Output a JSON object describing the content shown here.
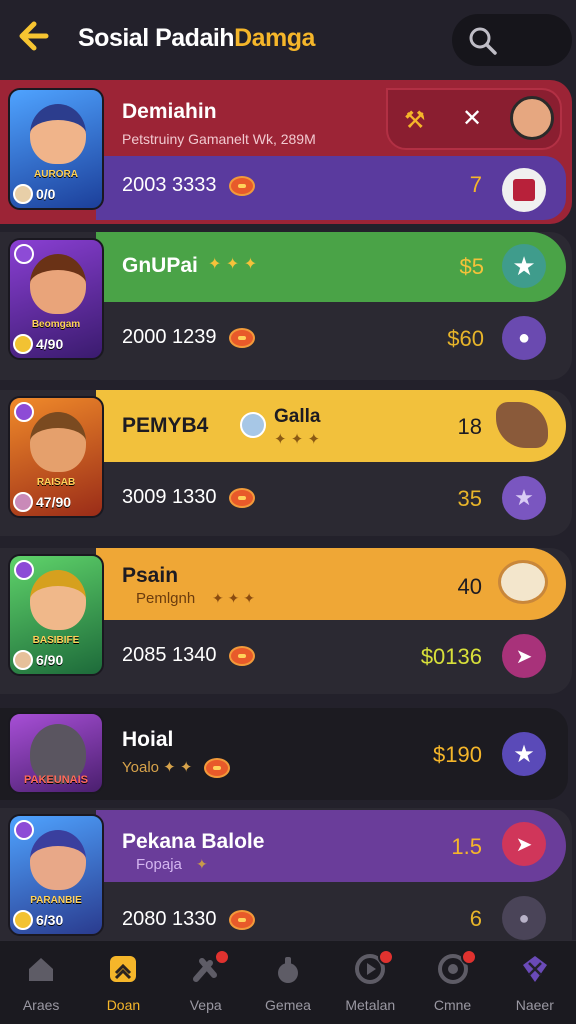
{
  "header": {
    "back_icon": "arrow-left-icon",
    "title_part1": "Sosial Padaih",
    "title_part2": "Damga",
    "search_icon": "search-icon",
    "accent": "#f5b62a"
  },
  "rows": [
    {
      "name": "Demiahin",
      "subtitle": "Petstruiny Gamanelt Wk, 289M",
      "value": "2003 3333",
      "amount": "7",
      "thumb_label": "AURORA",
      "thumb_num": "0/0",
      "band_color": "#9c2436",
      "lower_color": "#5a3a9e",
      "button_icon": "gift-icon",
      "button_color": "#f0f0f0"
    },
    {
      "name": "GnUPai",
      "subtitle": "",
      "amount_top": "$5",
      "value": "2000 1239",
      "amount": "$60",
      "thumb_label": "Beomgam",
      "thumb_num": "4/90",
      "band_color": "#4aa347",
      "button_icon": "star-icon",
      "button_icon2": "person-icon"
    },
    {
      "name": "PEMYB4",
      "name2": "Galla",
      "amount_top": "18",
      "value": "3009 1330",
      "amount": "35",
      "thumb_label": "RAISAB",
      "thumb_num": "47/90",
      "band_color": "#f2c13c",
      "button_icon": "star-icon"
    },
    {
      "name": "Psain",
      "subtitle": "Pemlgnh",
      "amount_top": "40",
      "value": "2085 1340",
      "amount": "$0136",
      "thumb_label": "BASIBIFE",
      "thumb_num": "6/90",
      "band_color": "#efa736",
      "button_icon": "send-icon"
    },
    {
      "name": "Hoial",
      "subtitle": "Yoalo",
      "amount": "$190",
      "thumb_label": "PAKEUNAIS",
      "band_color": "#2b2930",
      "button_icon": "star-icon"
    },
    {
      "name": "Pekana Balole",
      "subtitle": "Fopaja",
      "amount_top": "1.5",
      "value": "2080 1330",
      "amount": "6",
      "thumb_label": "PARANBIE",
      "thumb_num": "6/30",
      "band_color": "#6a3d9a",
      "button_icon": "send-icon",
      "button_icon2": "person-icon"
    }
  ],
  "nav": [
    {
      "label": "Araes",
      "icon": "home-icon",
      "active": false
    },
    {
      "label": "Doan",
      "icon": "rank-icon",
      "active": true
    },
    {
      "label": "Vepa",
      "icon": "tools-icon",
      "active": false
    },
    {
      "label": "Gemea",
      "icon": "bag-icon",
      "active": false
    },
    {
      "label": "Metalan",
      "icon": "play-icon",
      "active": false
    },
    {
      "label": "Cmne",
      "icon": "target-icon",
      "active": false
    },
    {
      "label": "Naeer",
      "icon": "gem-icon",
      "active": false
    }
  ]
}
